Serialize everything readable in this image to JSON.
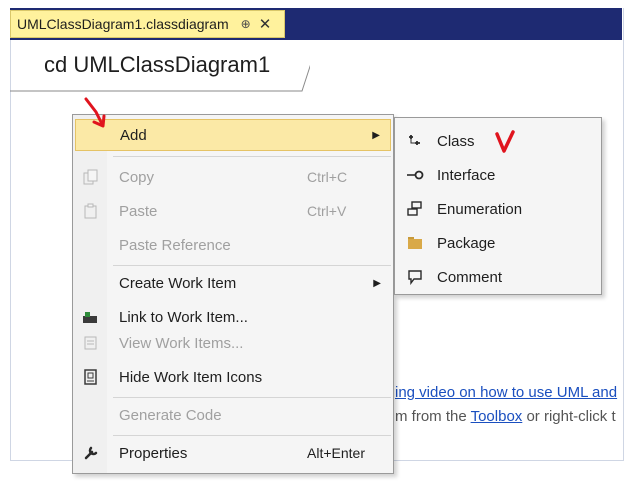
{
  "tab": {
    "title": "UMLClassDiagram1.classdiagram",
    "pin_glyph": "⊕",
    "close_glyph": "✕"
  },
  "diagram": {
    "title": "cd UMLClassDiagram1"
  },
  "hint": {
    "line1_link": "ing video on how to use UML and",
    "line2_prefix": "m from the ",
    "line2_link": "Toolbox",
    "line2_suffix": " or right-click t"
  },
  "context_menu": {
    "items": [
      {
        "label": "Add",
        "shortcut": "",
        "submenu": true,
        "enabled": true,
        "icon": "none"
      },
      {
        "label": "Copy",
        "shortcut": "Ctrl+C",
        "submenu": false,
        "enabled": false,
        "icon": "copy-icon"
      },
      {
        "label": "Paste",
        "shortcut": "Ctrl+V",
        "submenu": false,
        "enabled": false,
        "icon": "paste-icon"
      },
      {
        "label": "Paste Reference",
        "shortcut": "",
        "submenu": false,
        "enabled": false,
        "icon": "none"
      },
      {
        "label": "Create Work Item",
        "shortcut": "",
        "submenu": true,
        "enabled": true,
        "icon": "none"
      },
      {
        "label": "Link to Work Item...",
        "shortcut": "",
        "submenu": false,
        "enabled": true,
        "icon": "link-work-item-icon"
      },
      {
        "label": "View Work Items...",
        "shortcut": "",
        "submenu": false,
        "enabled": false,
        "icon": "view-work-items-icon"
      },
      {
        "label": "Hide Work Item Icons",
        "shortcut": "",
        "submenu": false,
        "enabled": true,
        "icon": "hide-work-item-icons-icon"
      },
      {
        "label": "Generate Code",
        "shortcut": "",
        "submenu": false,
        "enabled": false,
        "icon": "none"
      },
      {
        "label": "Properties",
        "shortcut": "Alt+Enter",
        "submenu": false,
        "enabled": true,
        "icon": "wrench-icon"
      }
    ]
  },
  "add_submenu": {
    "items": [
      {
        "label": "Class",
        "icon": "class-icon"
      },
      {
        "label": "Interface",
        "icon": "interface-icon"
      },
      {
        "label": "Enumeration",
        "icon": "enumeration-icon"
      },
      {
        "label": "Package",
        "icon": "package-icon"
      },
      {
        "label": "Comment",
        "icon": "comment-icon"
      }
    ]
  },
  "colors": {
    "tab_active": "#fff29d",
    "tab_strip": "#1e2a72",
    "menu_hover": "#fbe9a6",
    "annotation_red": "#e0141e",
    "link_blue": "#1a4fbf"
  }
}
